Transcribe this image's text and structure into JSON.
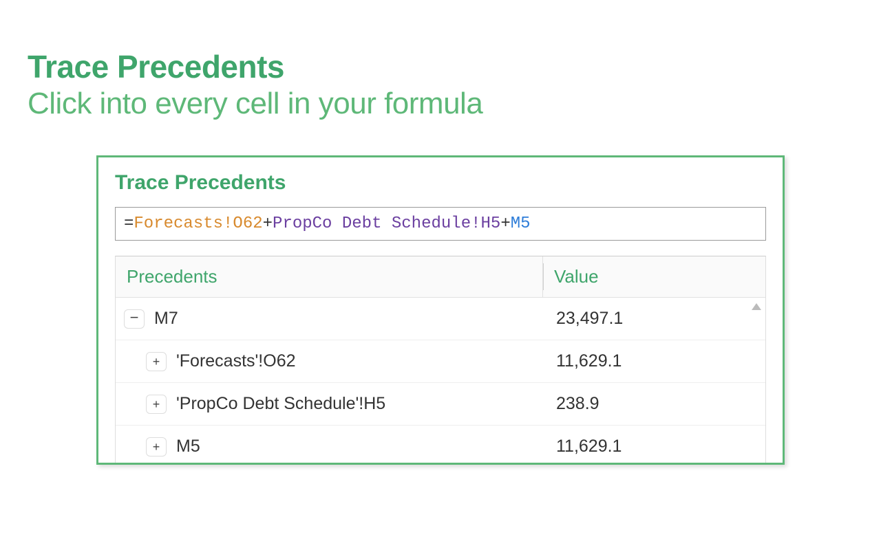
{
  "header": {
    "title": "Trace Precedents",
    "subtitle": "Click into every cell in your formula"
  },
  "panel": {
    "title": "Trace Precedents",
    "formula": {
      "equals": "=",
      "ref1": "Forecasts!O62",
      "op1": "+",
      "ref2": "PropCo Debt Schedule!H5",
      "op2": "+",
      "ref3": "M5"
    },
    "columns": {
      "precedents": "Precedents",
      "value": "Value"
    },
    "rows": [
      {
        "toggle": "−",
        "indent": 0,
        "label": "M7",
        "value": "23,497.1"
      },
      {
        "toggle": "+",
        "indent": 1,
        "label": "'Forecasts'!O62",
        "value": "11,629.1"
      },
      {
        "toggle": "+",
        "indent": 1,
        "label": "'PropCo Debt Schedule'!H5",
        "value": "238.9"
      },
      {
        "toggle": "+",
        "indent": 1,
        "label": "M5",
        "value": "11,629.1"
      }
    ]
  }
}
